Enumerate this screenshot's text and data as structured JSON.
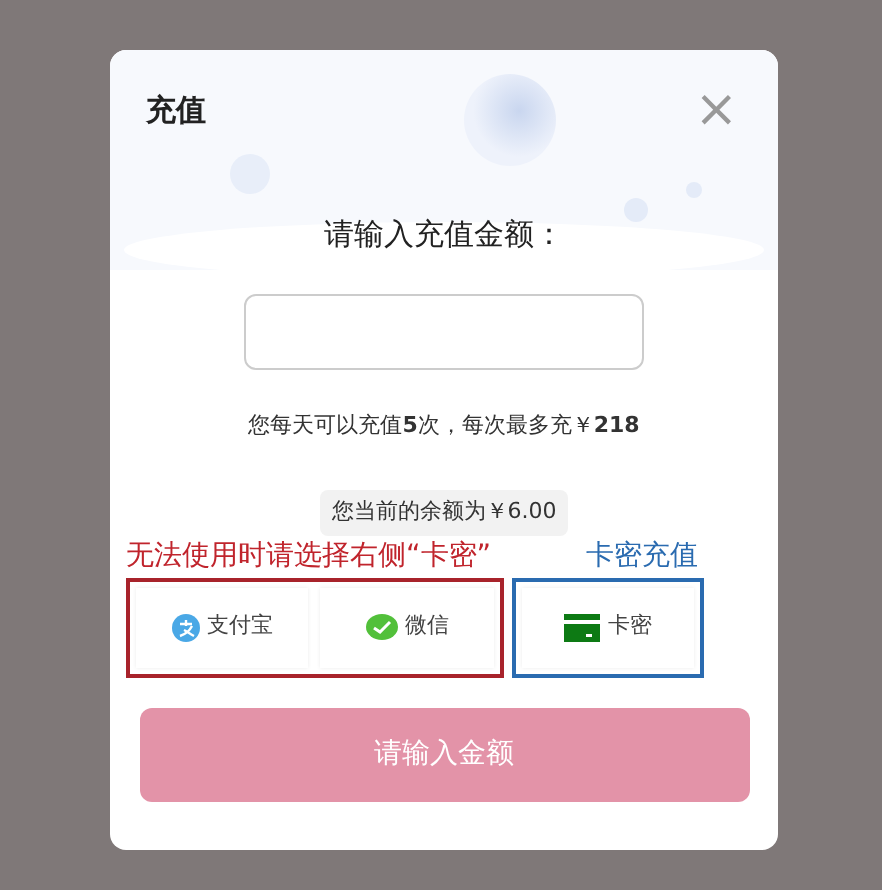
{
  "dialog": {
    "title": "充值",
    "close": "×",
    "prompt": "请输入充值金额：",
    "limit_note": "您每天可以充值**5**次，每次最多充￥**218**",
    "balance": "您当前的余额为￥6.00"
  },
  "annotations": [
    {
      "text": "无法使用时请选择右侧“卡密”",
      "color": "#c0242c"
    },
    {
      "text": "卡密充值",
      "color": "#2a6bb0"
    }
  ],
  "payment_groups": [
    {
      "color": "#a8232b",
      "methods": [
        {
          "kind": "alipay",
          "label": "支付宝"
        },
        {
          "kind": "wechat",
          "label": "微信"
        }
      ]
    },
    {
      "color": "#2a6bb0",
      "methods": [
        {
          "kind": "card",
          "label": "卡密"
        }
      ]
    }
  ],
  "submit": {
    "label": "请输入金额",
    "disabled": true
  }
}
